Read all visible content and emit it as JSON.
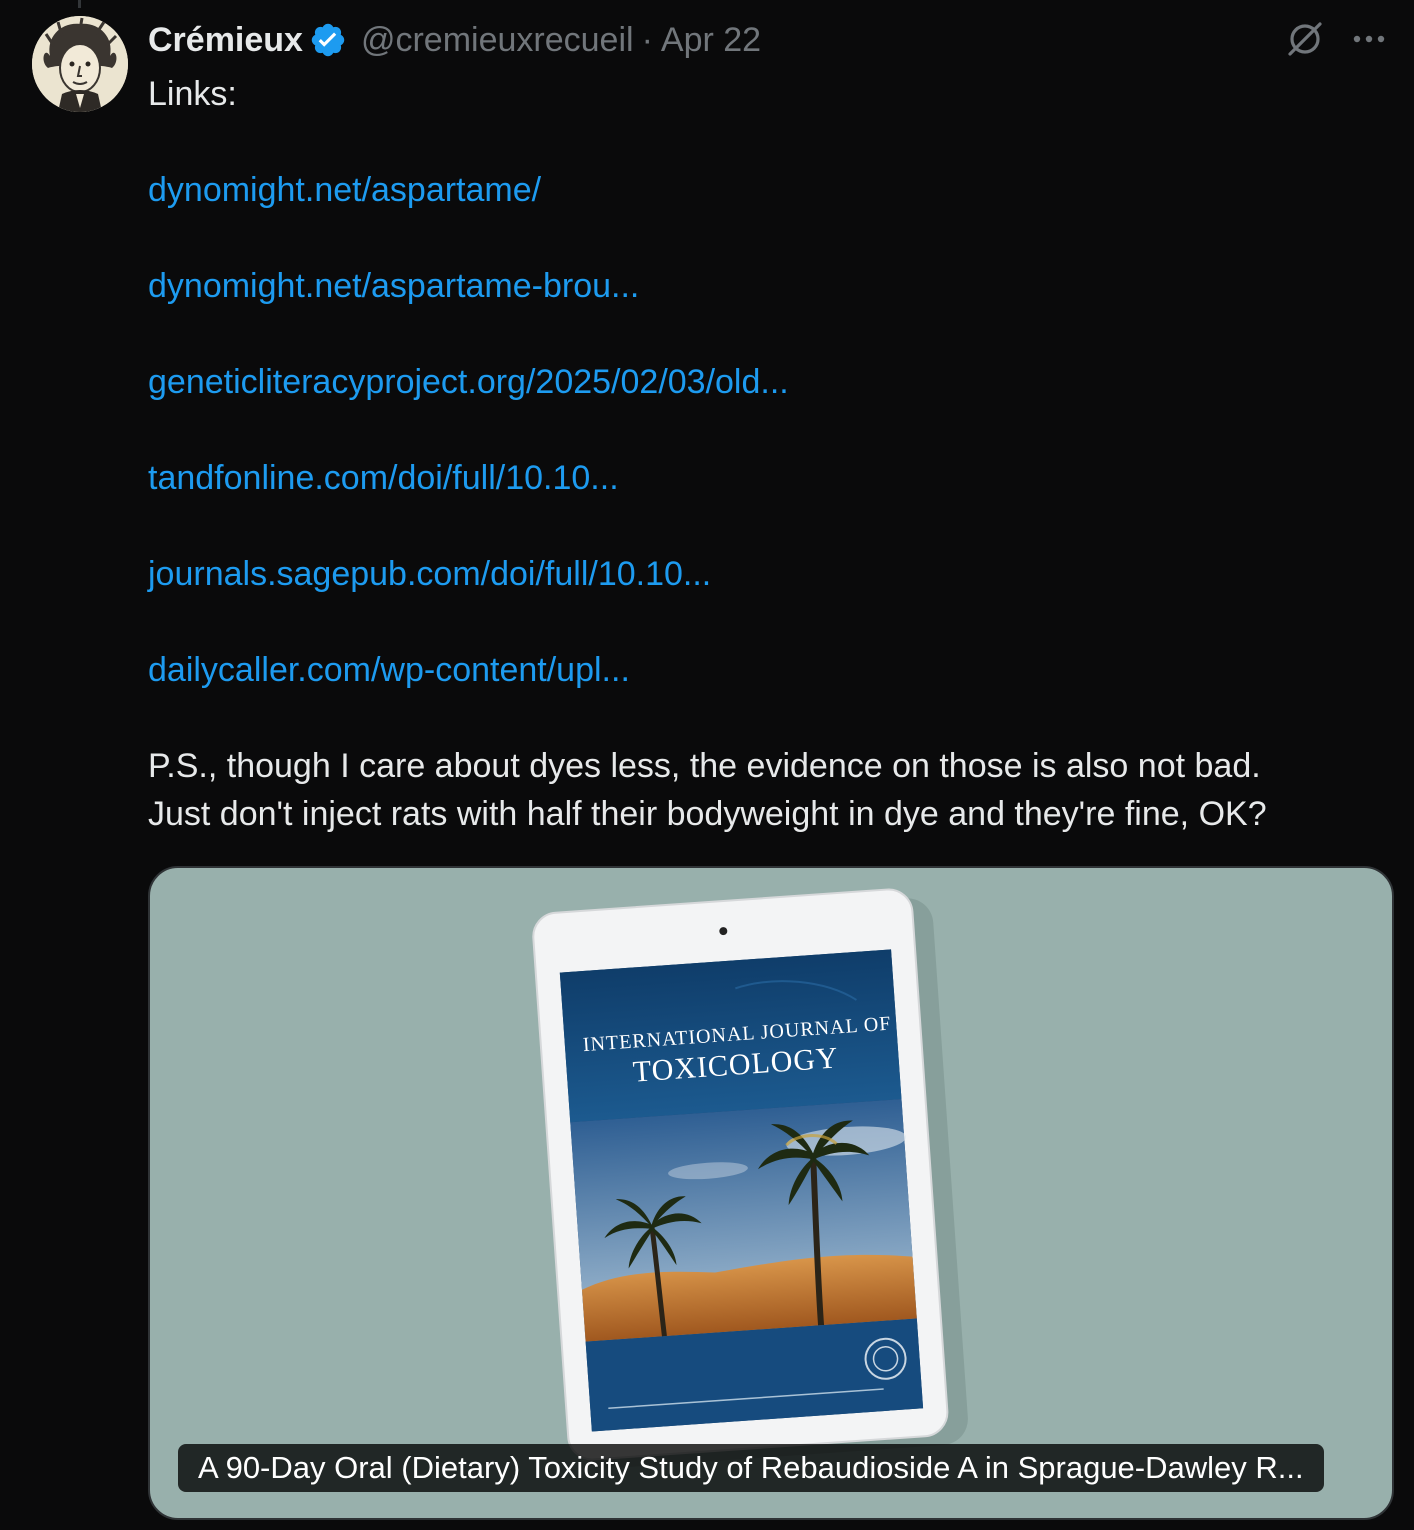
{
  "tweet": {
    "author_name": "Crémieux",
    "handle": "@cremieuxrecueil",
    "separator": "·",
    "date": "Apr 22",
    "intro": "Links:",
    "links": [
      "dynomight.net/aspartame/",
      "dynomight.net/aspartame-brou...",
      "geneticliteracyproject.org/2025/02/03/old...",
      "tandfonline.com/doi/full/10.10...",
      "journals.sagepub.com/doi/full/10.10...",
      "dailycaller.com/wp-content/upl..."
    ],
    "ps_line_1": "P.S., though I care about dyes less, the evidence on those is also not bad.",
    "ps_line_2": "Just don't inject rats with half their bodyweight in dye and they're fine, OK?"
  },
  "card": {
    "journal_line_1": "INTERNATIONAL JOURNAL OF",
    "journal_line_2": "TOXICOLOGY",
    "caption": "A 90-Day Oral (Dietary) Toxicity Study of Rebaudioside A in Sprague-Dawley R..."
  },
  "icons": {
    "verified": "verified-badge-icon",
    "grok": "grok-icon",
    "more": "more-options-icon"
  },
  "colors": {
    "background": "#0a0a0b",
    "link": "#1d9bf0",
    "muted": "#71767b",
    "card_background": "#98b0ac"
  }
}
